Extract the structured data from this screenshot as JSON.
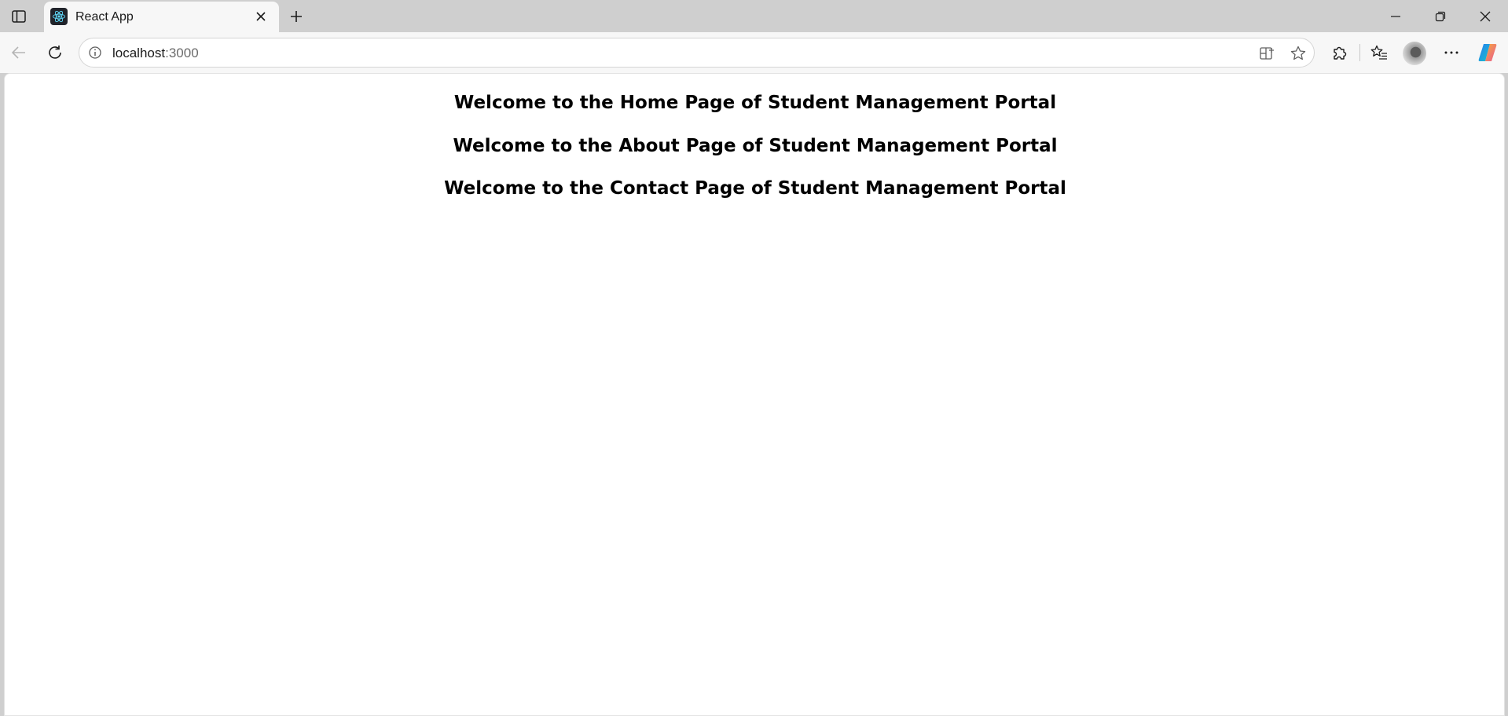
{
  "browser": {
    "tab": {
      "title": "React App"
    },
    "address_bar": {
      "host": "localhost",
      "port": ":3000"
    }
  },
  "page": {
    "headings": [
      "Welcome to the Home Page of Student Management Portal",
      "Welcome to the About Page of Student Management Portal",
      "Welcome to the Contact Page of Student Management Portal"
    ]
  },
  "icons": {
    "favicon": "react-logo-icon",
    "info": "info-icon",
    "app_available": "app-available-icon",
    "favorite": "star-icon",
    "extensions": "puzzle-icon",
    "favorites_bar": "favorites-list-icon",
    "more": "ellipsis-icon",
    "copilot": "copilot-icon"
  },
  "colors": {
    "chrome_bg": "#cfcfcf",
    "toolbar_bg": "#f7f7f7",
    "page_bg": "#ffffff",
    "text": "#000000"
  }
}
